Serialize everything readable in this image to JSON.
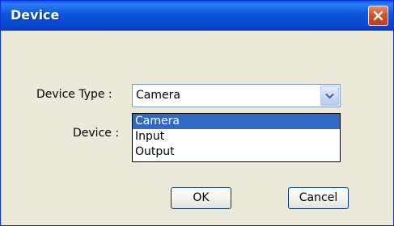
{
  "window": {
    "title": "Device"
  },
  "form": {
    "device_type_label": "Device Type :",
    "device_label": "Device :",
    "device_type_value": "Camera",
    "device_type_options": [
      "Camera",
      "Input",
      "Output"
    ]
  },
  "buttons": {
    "ok": "OK",
    "cancel": "Cancel"
  },
  "colors": {
    "titlebar": "#0a5ee6",
    "selection": "#316ac5",
    "dialog_bg": "#ece9d8"
  },
  "icons": {
    "close": "close-icon",
    "dropdown": "chevron-down-icon"
  }
}
